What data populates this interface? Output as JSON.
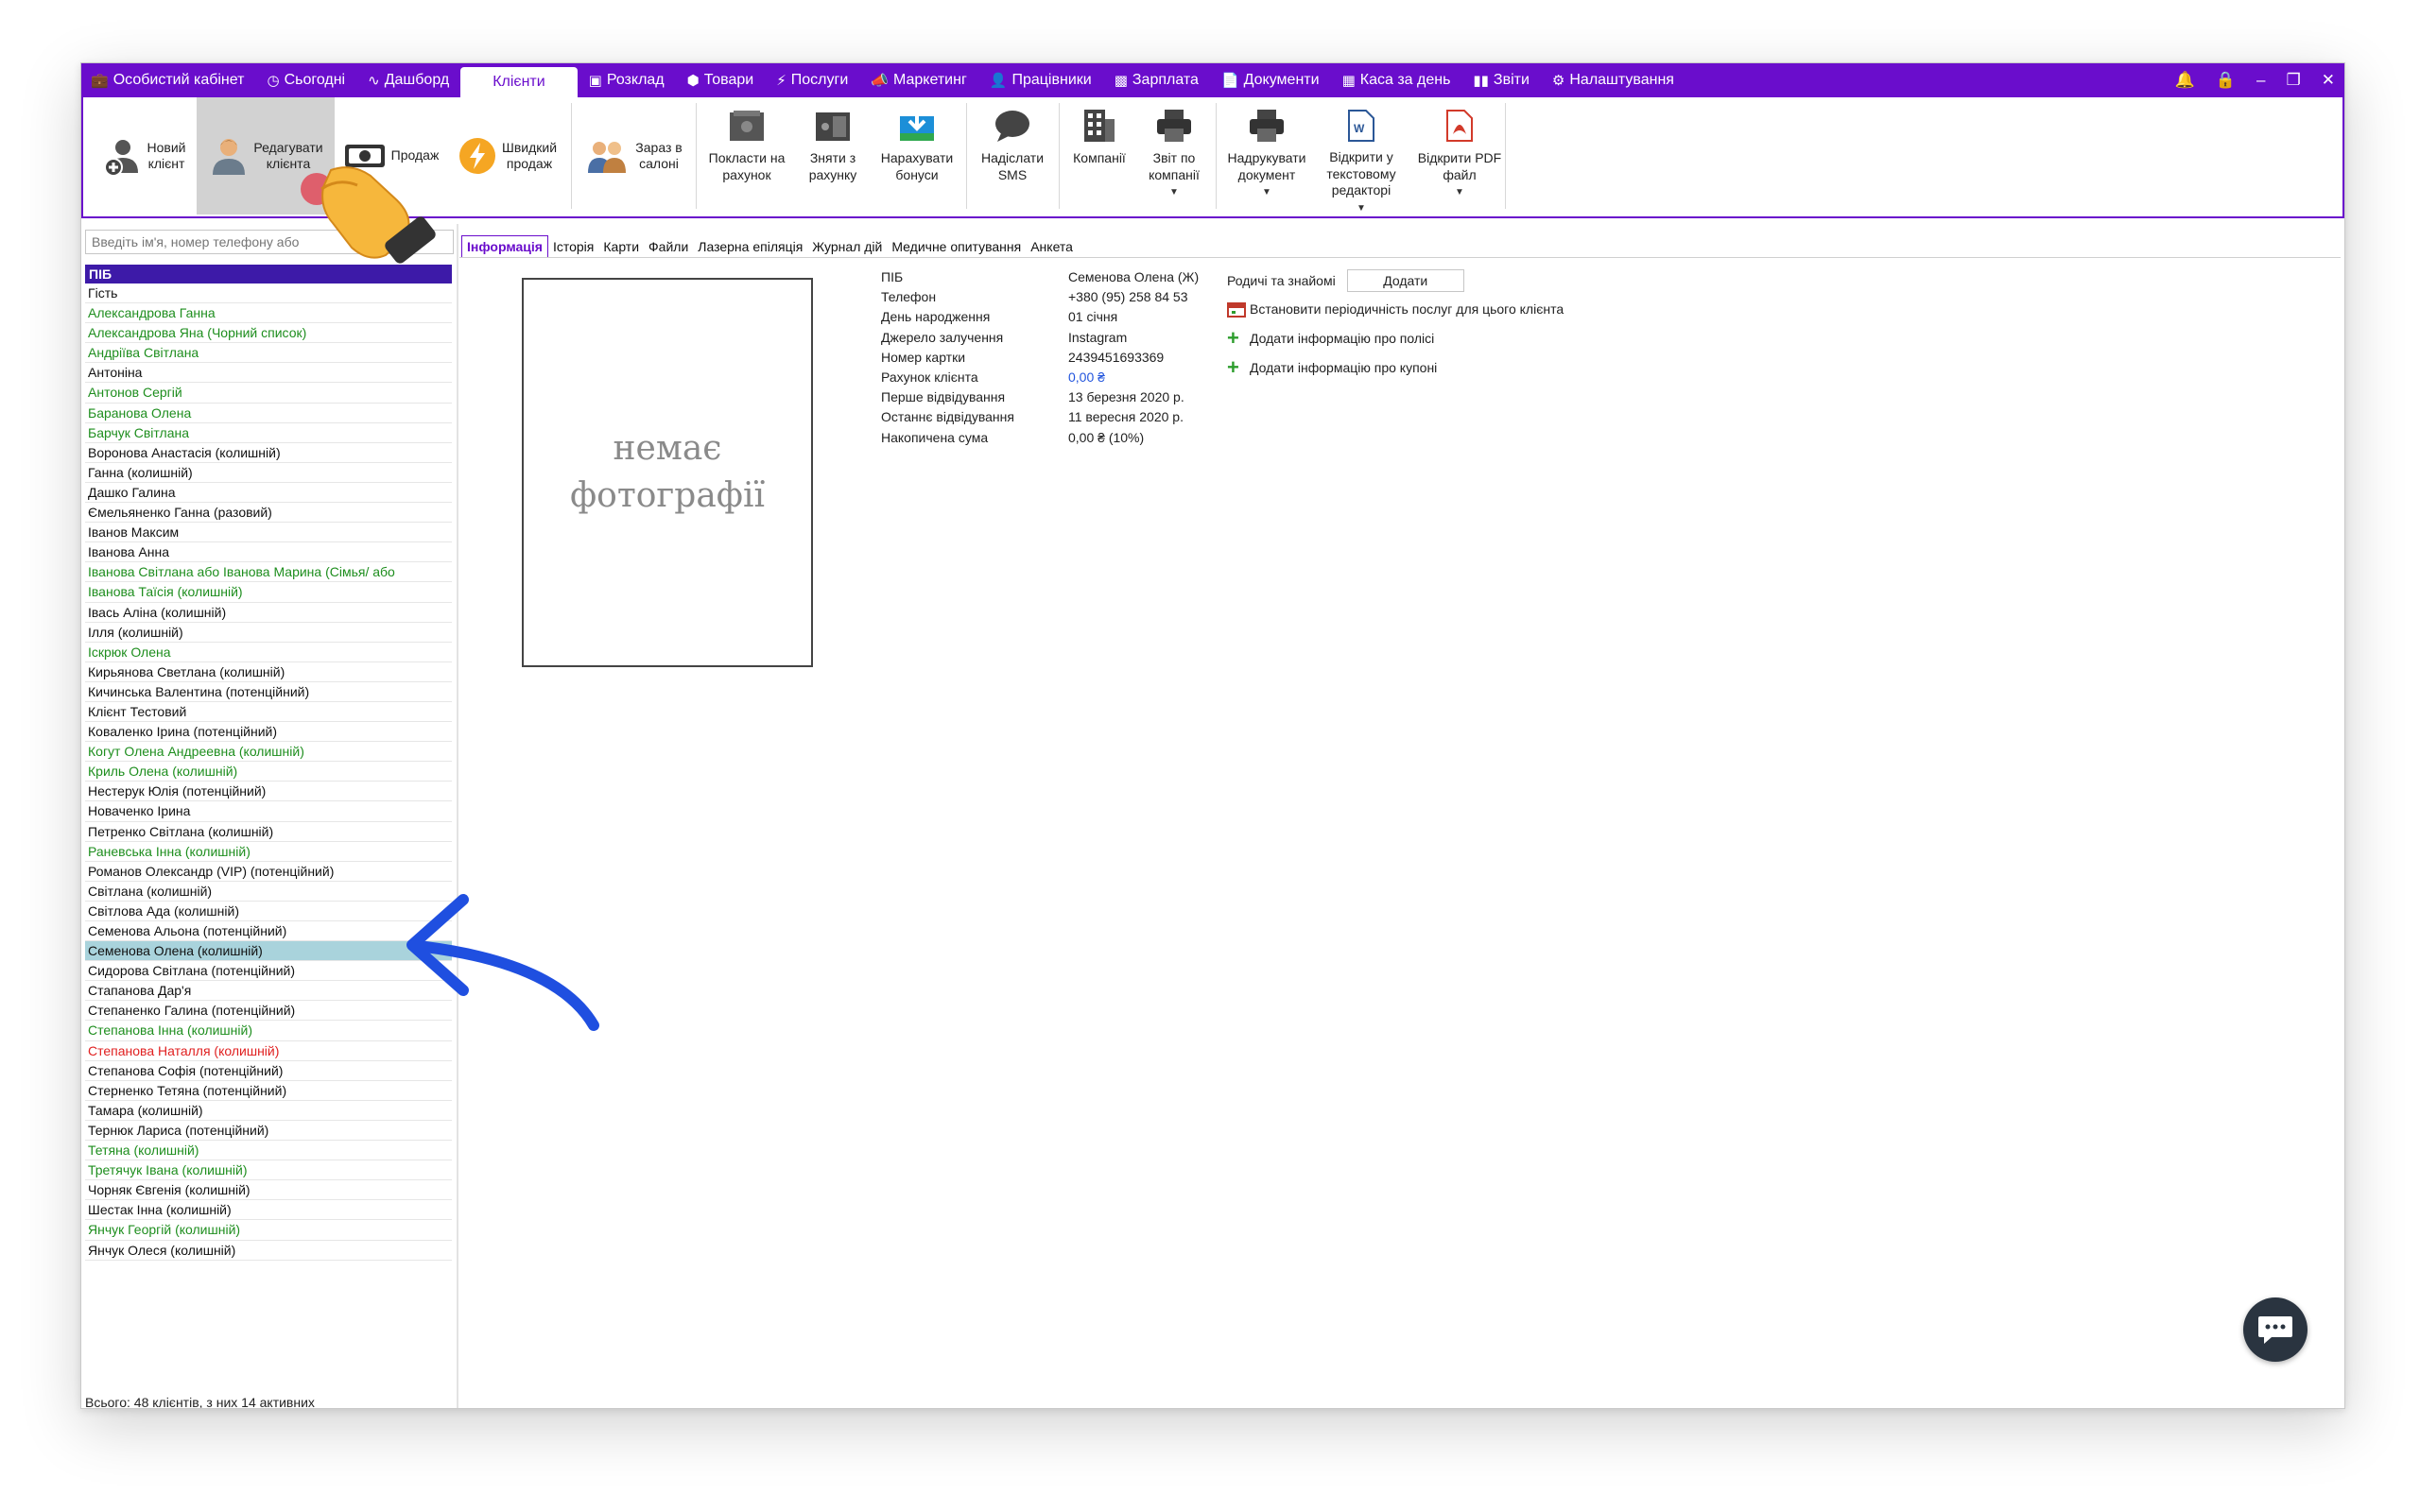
{
  "menubar": {
    "items": [
      {
        "label": "Особистий кабінет",
        "icon": "briefcase-icon"
      },
      {
        "label": "Сьогодні",
        "icon": "clock-icon"
      },
      {
        "label": "Дашборд",
        "icon": "pulse-icon"
      },
      {
        "label": "Клієнти",
        "icon": "",
        "active": true
      },
      {
        "label": "Розклад",
        "icon": "calendar-icon"
      },
      {
        "label": "Товари",
        "icon": "box-icon"
      },
      {
        "label": "Послуги",
        "icon": "lightning-icon"
      },
      {
        "label": "Маркетинг",
        "icon": "megaphone-icon"
      },
      {
        "label": "Працівники",
        "icon": "person-icon"
      },
      {
        "label": "Зарплата",
        "icon": "cash-icon"
      },
      {
        "label": "Документи",
        "icon": "document-icon"
      },
      {
        "label": "Каса за день",
        "icon": "calculator-icon"
      },
      {
        "label": "Звіти",
        "icon": "bar-chart-icon"
      },
      {
        "label": "Налаштування",
        "icon": "gear-icon"
      }
    ],
    "window_controls": [
      "bell-icon",
      "lock-icon",
      "minimize-icon",
      "restore-icon",
      "close-icon"
    ]
  },
  "ribbon": {
    "new_client": "Новий\nклієнт",
    "edit_client": "Редагувати\nклієнта",
    "sale": "Продаж",
    "quick_sale": "Швидкий\nпродаж",
    "in_salon": "Зараз в\nсалоні",
    "deposit": "Покласти на\nрахунок",
    "withdraw": "Зняти з\nрахунку",
    "bonus": "Нарахувати\nбонуси",
    "sms": "Надіслати\nSMS",
    "companies": "Компанії",
    "company_report": "Звіт по\nкомпанії",
    "print_doc": "Надрукувати\nдокумент",
    "open_text": "Відкрити у\nтекстовому\nредакторі",
    "open_pdf": "Відкрити PDF\nфайл"
  },
  "search": {
    "placeholder": "Введіть ім'я, номер телефону або"
  },
  "list": {
    "header": "ПІБ",
    "footer": "Всього: 48 клієнтів, з них 14 активних",
    "clients": [
      {
        "name": "Гість",
        "color": "black"
      },
      {
        "name": "Александрова Ганна",
        "color": "green"
      },
      {
        "name": "Александрова Яна (Чорний список)",
        "color": "green"
      },
      {
        "name": "Андріїва Світлана",
        "color": "green"
      },
      {
        "name": "Антоніна",
        "color": "black"
      },
      {
        "name": "Антонов Сергій",
        "color": "green"
      },
      {
        "name": "Баранова Олена",
        "color": "green"
      },
      {
        "name": "Барчук Світлана",
        "color": "green"
      },
      {
        "name": "Воронова Анастасія (колишній)",
        "color": "black"
      },
      {
        "name": "Ганна (колишній)",
        "color": "black"
      },
      {
        "name": "Дашко Галина",
        "color": "black"
      },
      {
        "name": "Ємельяненко Ганна (разовий)",
        "color": "black"
      },
      {
        "name": "Іванов Максим",
        "color": "black"
      },
      {
        "name": "Іванова Анна",
        "color": "black"
      },
      {
        "name": "Іванова Світлана або Іванова Марина (Сімья/ або",
        "color": "green"
      },
      {
        "name": "Іванова Таїсія (колишній)",
        "color": "green"
      },
      {
        "name": "Івась Аліна (колишній)",
        "color": "black"
      },
      {
        "name": "Ілля (колишній)",
        "color": "black"
      },
      {
        "name": "Іскрюк Олена",
        "color": "green"
      },
      {
        "name": "Кирьянова Светлана (колишній)",
        "color": "black"
      },
      {
        "name": "Кичинська Валентина (потенційний)",
        "color": "black"
      },
      {
        "name": "Клієнт Тестовий",
        "color": "black"
      },
      {
        "name": "Коваленко Ірина (потенційний)",
        "color": "black"
      },
      {
        "name": "Когут Олена Андреевна (колишній)",
        "color": "green"
      },
      {
        "name": "Криль Олена (колишній)",
        "color": "green"
      },
      {
        "name": "Нестерук Юлія (потенційний)",
        "color": "black"
      },
      {
        "name": "Новаченко Ірина",
        "color": "black"
      },
      {
        "name": "Петренко Світлана (колишній)",
        "color": "black"
      },
      {
        "name": "Раневська Інна (колишній)",
        "color": "green"
      },
      {
        "name": "Романов Олександр (VIP) (потенційний)",
        "color": "black"
      },
      {
        "name": "Світлана (колишній)",
        "color": "black"
      },
      {
        "name": "Світлова Ада (колишній)",
        "color": "black"
      },
      {
        "name": "Семенова Альона (потенційний)",
        "color": "black"
      },
      {
        "name": "Семенова Олена (колишній)",
        "color": "black",
        "selected": true
      },
      {
        "name": "Сидорова Світлана (потенційний)",
        "color": "black"
      },
      {
        "name": "Стапанова Дар'я",
        "color": "black"
      },
      {
        "name": "Степаненко Галина (потенційний)",
        "color": "black"
      },
      {
        "name": "Степанова Інна (колишній)",
        "color": "green"
      },
      {
        "name": "Степанова Наталля (колишній)",
        "color": "red"
      },
      {
        "name": "Степанова Софія (потенційний)",
        "color": "black"
      },
      {
        "name": "Стерненко Тетяна (потенційний)",
        "color": "black"
      },
      {
        "name": "Тамара (колишній)",
        "color": "black"
      },
      {
        "name": "Тернюк Лариса (потенційний)",
        "color": "black"
      },
      {
        "name": "Тетяна (колишній)",
        "color": "green"
      },
      {
        "name": "Третячук Івана (колишній)",
        "color": "green"
      },
      {
        "name": "Чорняк Євгенія (колишній)",
        "color": "black"
      },
      {
        "name": "Шестак Інна (колишній)",
        "color": "black"
      },
      {
        "name": "Янчук Георгій (колишній)",
        "color": "green"
      },
      {
        "name": "Янчук Олеся (колишній)",
        "color": "black"
      }
    ]
  },
  "tabs": [
    "Інформація",
    "Історія",
    "Карти",
    "Файли",
    "Лазерна епіляція",
    "Журнал дій",
    "Медичне опитування",
    "Анкета"
  ],
  "photo": {
    "placeholder": "немає\nфотографії"
  },
  "client_info": [
    {
      "label": "ПІБ",
      "value": "Семенова Олена (Ж)"
    },
    {
      "label": "Телефон",
      "value": "+380 (95) 258 84 53"
    },
    {
      "label": "День народження",
      "value": "01 січня"
    },
    {
      "label": "Джерело залучення",
      "value": "Instagram"
    },
    {
      "label": "Номер картки",
      "value": "2439451693369"
    },
    {
      "label": "Рахунок клієнта",
      "value": "0,00 ₴",
      "link": true
    },
    {
      "label": "Перше відвідування",
      "value": "13 березня 2020 р."
    },
    {
      "label": "Останнє відвідування",
      "value": "11 вересня 2020 р."
    },
    {
      "label": "Накопичена сума",
      "value": "0,00 ₴ (10%)"
    }
  ],
  "side": {
    "relatives_label": "Родичі та знайомі",
    "add_button": "Додати",
    "periodicity": "Встановити періодичність послуг для цього клієнта",
    "add_policy": "Додати інформацію про полісі",
    "add_coupon": "Додати інформацію про купоні"
  },
  "colors": {
    "brand": "#6a0dcc",
    "list_header": "#3d1aa8",
    "selected_row": "#a9d3dc",
    "green_text": "#1e8e1e",
    "red_text": "#e02020",
    "arrow": "#1f4fe0"
  }
}
